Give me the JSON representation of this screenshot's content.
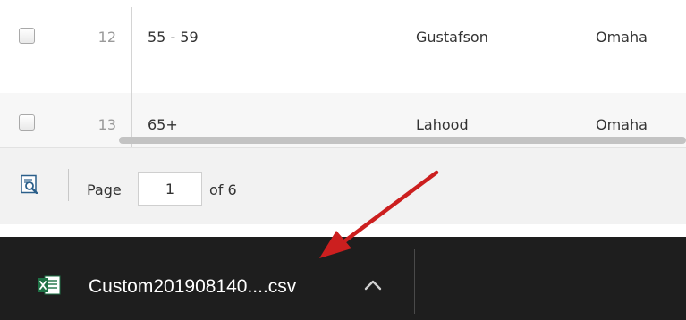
{
  "grid": {
    "rows": [
      {
        "number": "12",
        "age_range": "55 - 59",
        "last_name": "Gustafson",
        "city": "Omaha"
      },
      {
        "number": "13",
        "age_range": "65+",
        "last_name": "Lahood",
        "city": "Omaha"
      }
    ]
  },
  "pager": {
    "page_label": "Page",
    "current_page": "1",
    "of_label": "of 6",
    "icon": "search-page-icon"
  },
  "download": {
    "file_name": "Custom201908140....csv",
    "file_icon": "excel-file-icon",
    "menu_icon": "chevron-up-icon"
  },
  "colors": {
    "download_bar": "#1e1e1e",
    "excel_green": "#1e7145",
    "arrow_red": "#cc1f1f"
  }
}
